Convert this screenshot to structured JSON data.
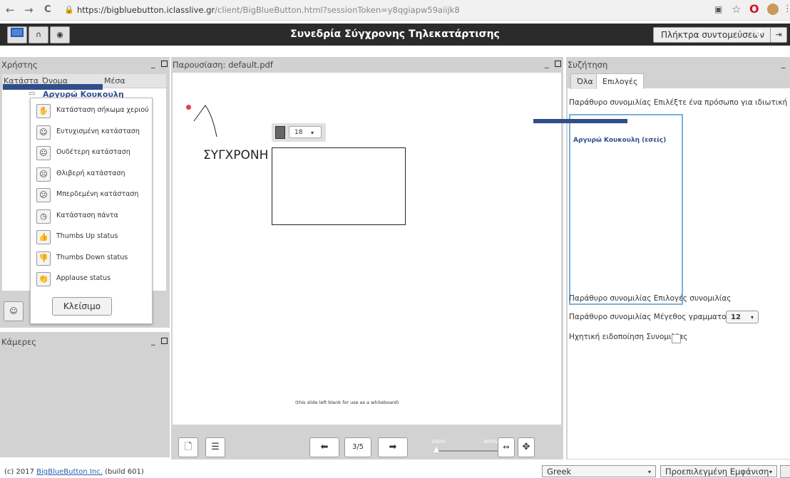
{
  "browser": {
    "url_host": "https://bigbluebutton.iclasslive.gr",
    "url_path": "/client/BigBlueButton.html?sessionToken=y8qgiapw59aiijk8",
    "back_icon": "←",
    "forward_icon": "→",
    "reload_icon": "C"
  },
  "header": {
    "title": "Συνεδρία Σύγχρονης Τηλεκατάρτισης",
    "shortcuts_label": "Πλήκτρα συντομεύσεων",
    "help_label": "?"
  },
  "users": {
    "title": "Χρήστης",
    "col_status": "Κατάστα",
    "col_name": "Όνομα",
    "col_media": "Μέσα",
    "user_name": "Αργυρώ Κουκουλη",
    "status_menu": [
      {
        "icon": "✋",
        "label": "Κατάσταση σήκωμα χεριού"
      },
      {
        "icon": "☺",
        "label": "Ευτυχισμένη κατάσταση"
      },
      {
        "icon": "😐",
        "label": "Ουδέτερη κατάσταση"
      },
      {
        "icon": "☹",
        "label": "Θλιβερή κατάσταση"
      },
      {
        "icon": "😕",
        "label": "Μπερδεμένη κατάσταση"
      },
      {
        "icon": "◷",
        "label": "Κατάσταση πάντα"
      },
      {
        "icon": "👍",
        "label": "Thumbs Up status"
      },
      {
        "icon": "👎",
        "label": "Thumbs Down status"
      },
      {
        "icon": "👏",
        "label": "Applause status"
      }
    ],
    "close_label": "Κλείσιμο"
  },
  "cameras": {
    "title": "Κάμερες"
  },
  "presentation": {
    "title": "Παρουσίαση: default.pdf",
    "font_size": "18",
    "text_tool_text": "ΣΥΓΧΡΟΝΗ",
    "blank_note": "(this slide left blank for use as a whiteboard)",
    "page": "3/5",
    "zoom_min": "100%",
    "zoom_max": "400%",
    "zoom_level": 0
  },
  "chat": {
    "title": "Συζήτηση",
    "tab_all": "Όλα",
    "tab_options": "Επιλογές",
    "private_hint": "Παράθυρο συνομιλίας Επιλέξτε ένα πρόσωπο για ιδιωτική συνομιλία",
    "user_entry": "Αργυρώ Κουκουλη (εσείς)",
    "options_label": "Παράθυρο συνομιλίας Επιλογές συνομιλίας",
    "font_size_label": "Παράθυρο συνομιλίας Μέγεθος γραμματοσειράς",
    "font_size_value": "12",
    "sound_label": "Ηχητική ειδοποίηση Συνομιλίας"
  },
  "footer": {
    "copyright_prefix": "(c) 2017",
    "copyright_link": "BigBlueButton Inc.",
    "copyright_suffix": "(build 601)",
    "language": "Greek",
    "layout": "Προεπιλεγμένη Εμφάνιση"
  }
}
